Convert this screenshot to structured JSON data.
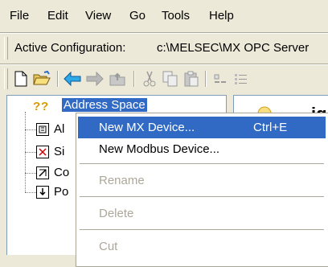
{
  "menu": [
    "File",
    "Edit",
    "View",
    "Go",
    "Tools",
    "Help"
  ],
  "config": {
    "label": "Active Configuration:",
    "value": "c:\\MELSEC\\MX OPC Server"
  },
  "toolbar_icons": [
    "new-document-icon",
    "open-folder-icon",
    "back-arrow-icon",
    "forward-arrow-icon",
    "up-folder-icon",
    "cut-icon",
    "copy-icon",
    "paste-icon",
    "large-icons-icon",
    "small-icons-icon"
  ],
  "tree": {
    "root": "Address Space",
    "children": [
      "Al",
      "Si",
      "Co",
      "Po"
    ]
  },
  "right_panel": {
    "partial_text": [
      "ig",
      "de",
      "m"
    ]
  },
  "context_menu": {
    "items": [
      {
        "label": "New MX Device...",
        "shortcut": "Ctrl+E",
        "highlighted": true,
        "disabled": false
      },
      {
        "label": "New Modbus Device...",
        "shortcut": "",
        "highlighted": false,
        "disabled": false
      },
      {
        "label": "Rename",
        "shortcut": "",
        "highlighted": false,
        "disabled": true
      },
      {
        "label": "Delete",
        "shortcut": "",
        "highlighted": false,
        "disabled": true
      },
      {
        "label": "Cut",
        "shortcut": "",
        "highlighted": false,
        "disabled": true
      }
    ]
  },
  "colors": {
    "highlight": "#316ac5",
    "window_bg": "#ece9d8",
    "disabled_text": "#aca899"
  }
}
